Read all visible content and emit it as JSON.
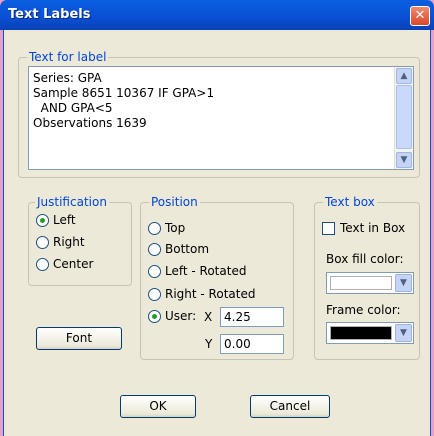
{
  "window": {
    "title": "Text Labels"
  },
  "text_group": {
    "legend": "Text for label",
    "lines": [
      "Series: GPA",
      "Sample 8651 10367 IF GPA>1",
      "  AND GPA<5",
      "Observations 1639"
    ]
  },
  "justification": {
    "legend": "Justification",
    "options": [
      "Left",
      "Right",
      "Center"
    ],
    "selected": "Left"
  },
  "position": {
    "legend": "Position",
    "options": [
      "Top",
      "Bottom",
      "Left - Rotated",
      "Right - Rotated",
      "User:"
    ],
    "selected": "User:",
    "x_label": "X",
    "x_value": "4.25",
    "y_label": "Y",
    "y_value": "0.00"
  },
  "textbox": {
    "legend": "Text box",
    "text_in_box_label": "Text in Box",
    "text_in_box_checked": false,
    "fill_label": "Box fill color:",
    "fill_color": "#ffffff",
    "frame_label": "Frame color:",
    "frame_color": "#000000"
  },
  "buttons": {
    "font": "Font",
    "ok": "OK",
    "cancel": "Cancel"
  },
  "icons": {
    "close": "close-icon",
    "scroll_up": "scroll-up-icon",
    "scroll_down": "scroll-down-icon",
    "dropdown": "chevron-down-icon"
  }
}
